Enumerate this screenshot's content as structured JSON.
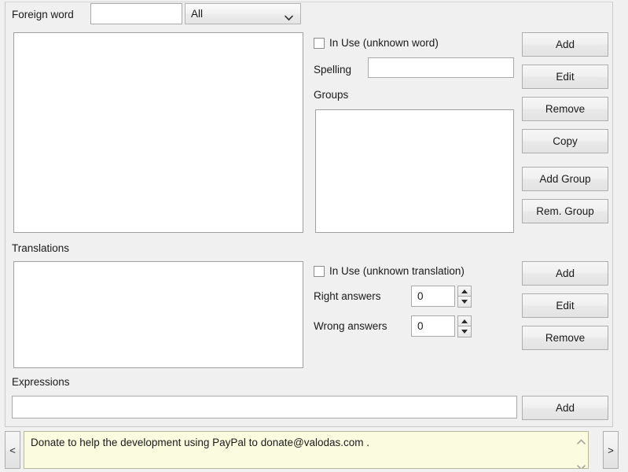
{
  "foreign_word": {
    "label": "Foreign word",
    "search_value": "",
    "filter_selected": "All",
    "filter_options": [
      "All"
    ],
    "list_items": []
  },
  "word_detail": {
    "in_use_label": "In Use (unknown word)",
    "in_use_checked": false,
    "spelling_label": "Spelling",
    "spelling_value": "",
    "groups_label": "Groups",
    "groups_items": []
  },
  "word_buttons": {
    "add": "Add",
    "edit": "Edit",
    "remove": "Remove",
    "copy": "Copy",
    "add_group": "Add Group",
    "rem_group": "Rem. Group"
  },
  "translations": {
    "label": "Translations",
    "list_items": [],
    "in_use_label": "In Use (unknown translation)",
    "in_use_checked": false,
    "right_answers_label": "Right answers",
    "right_answers_value": "0",
    "wrong_answers_label": "Wrong answers",
    "wrong_answers_value": "0",
    "buttons": {
      "add": "Add",
      "edit": "Edit",
      "remove": "Remove"
    }
  },
  "expressions": {
    "label": "Expressions",
    "input_value": "",
    "add_button": "Add"
  },
  "donation": {
    "prev_label": "<",
    "next_label": ">",
    "message": "Donate to help the development using PayPal to donate@valodas.com ."
  },
  "colors": {
    "window_background": "#f0f0f0",
    "field_background": "#ffffff",
    "donation_background": "#fbfbe0",
    "border": "#a0a0a0",
    "text": "#1a1a1a"
  }
}
